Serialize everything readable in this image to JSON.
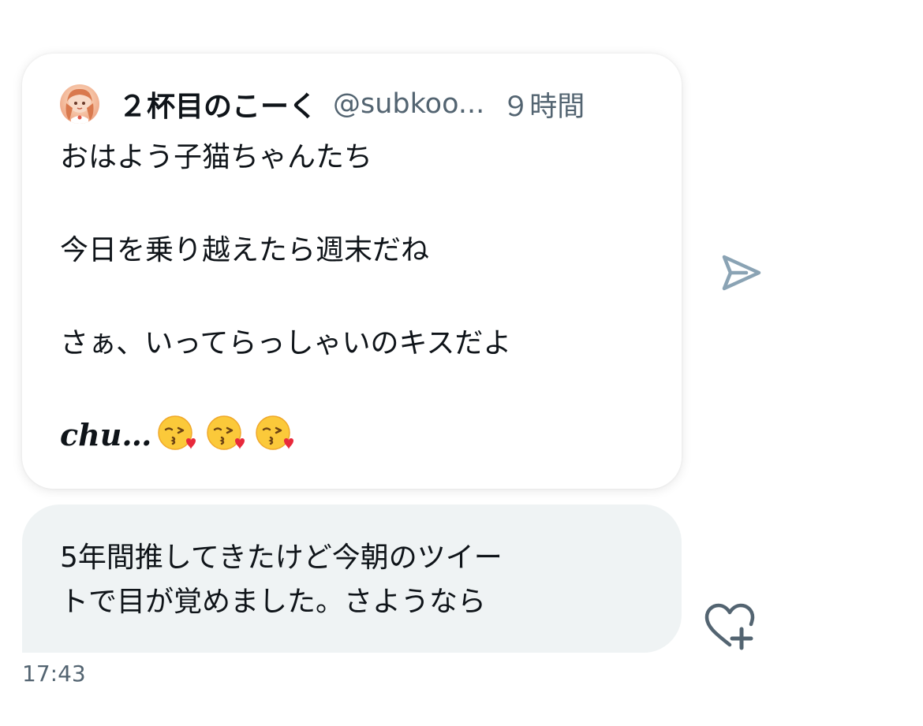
{
  "quoted_tweet": {
    "display_name": "２杯目のこーく",
    "handle": "@subkoo...",
    "time_ago": "９時間",
    "avatar_icon": "user-avatar-anime-girl",
    "lines": [
      "おはよう子猫ちゃんたち",
      "今日を乗り越えたら週末だね",
      "さぁ、いってらっしゃいのキスだよ"
    ],
    "chu_text": "chu…",
    "emoji_names": [
      "face-blowing-kiss-emoji",
      "face-blowing-kiss-emoji",
      "face-blowing-kiss-emoji"
    ]
  },
  "share_icon": "send-icon",
  "reply_message": {
    "lines": [
      "5年間推してきたけど今朝のツイー",
      "トで目が覚めました。さようなら"
    ],
    "timestamp": "17:43"
  },
  "react_icon": "heart-plus-icon",
  "colors": {
    "text_primary": "#0f1419",
    "text_secondary": "#536471",
    "bubble_bg": "#eff3f4",
    "icon_gray": "#8aa3b4"
  }
}
